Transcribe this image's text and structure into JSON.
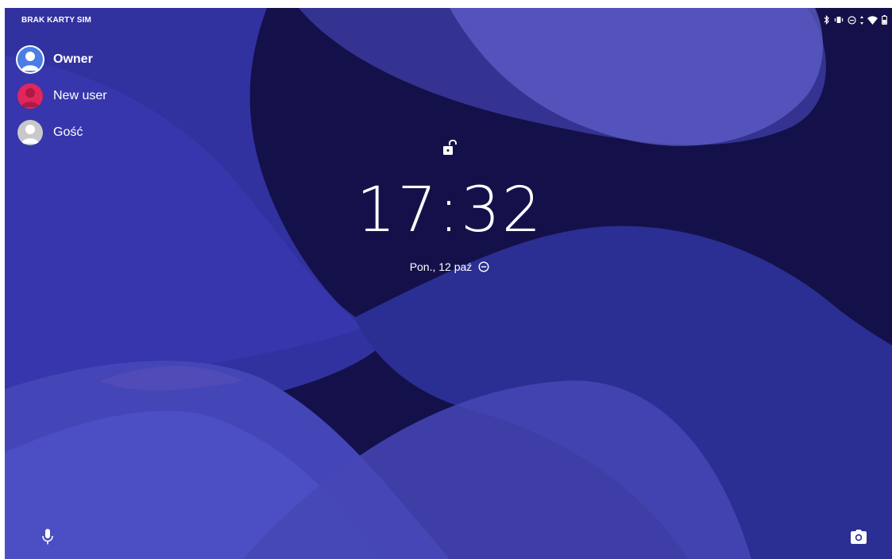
{
  "status_bar": {
    "carrier": "BRAK KARTY SIM",
    "icons": [
      "bluetooth-icon",
      "vibrate-icon",
      "do-not-disturb-icon",
      "data-activity-icon",
      "wifi-icon",
      "battery-icon"
    ]
  },
  "users": [
    {
      "name": "Owner",
      "avatar": "owner-avatar",
      "color": "#4a7ee6",
      "selected": true
    },
    {
      "name": "New user",
      "avatar": "new-user-avatar",
      "color": "#e0265b",
      "selected": false
    },
    {
      "name": "Gość",
      "avatar": "guest-avatar",
      "color": "#c9c9c9",
      "selected": false
    }
  ],
  "lock": {
    "icon": "unlocked-padlock-icon"
  },
  "clock": {
    "time": "17:32"
  },
  "date": {
    "text": "Pon., 12 paź",
    "icon": "do-not-disturb-icon"
  },
  "bottom": {
    "left_icon": "microphone-icon",
    "right_icon": "camera-icon"
  },
  "colors": {
    "background": "#14114a",
    "wave_light": "#5a56c4",
    "wave_mid": "#3a3aa6"
  }
}
